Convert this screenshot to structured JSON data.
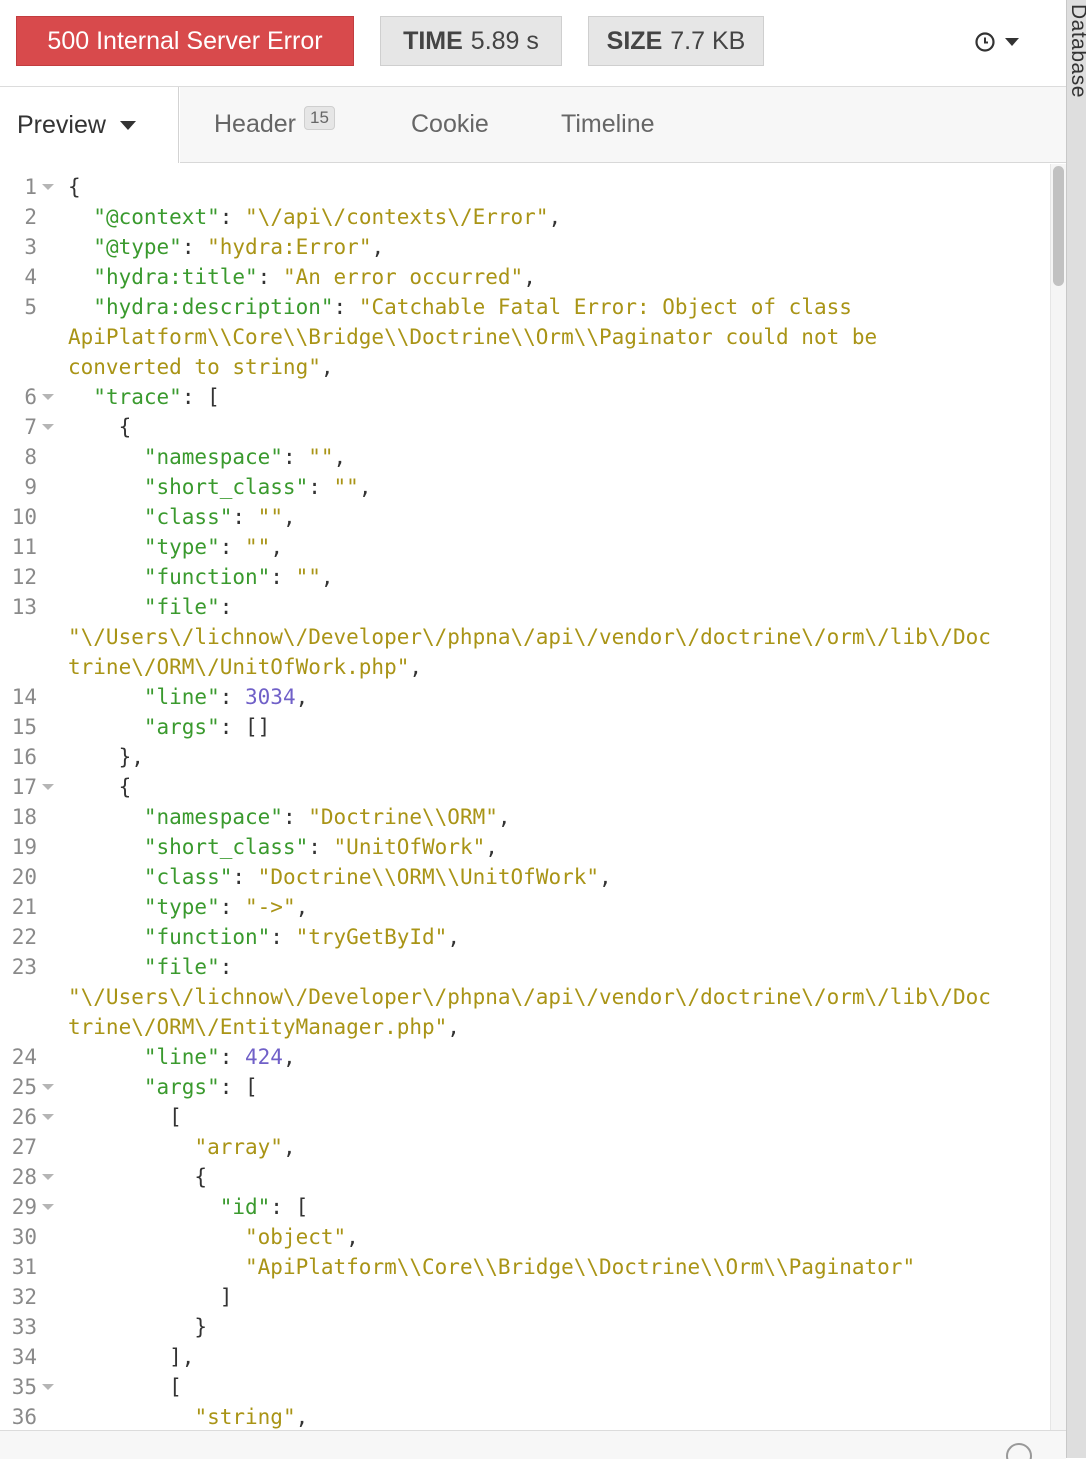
{
  "status": {
    "code": "500",
    "text": "Internal Server Error",
    "color": "#d84a4c"
  },
  "time": {
    "label": "TIME",
    "value": "5.89 s"
  },
  "size": {
    "label": "SIZE",
    "value": "7.7 KB"
  },
  "history": {
    "icon": "clock-icon",
    "caret": "chevron-down-icon"
  },
  "side_panel": {
    "label": "Database"
  },
  "tabs": {
    "preview": "Preview",
    "header": "Header",
    "header_count": "15",
    "cookie": "Cookie",
    "timeline": "Timeline"
  },
  "colors": {
    "key": "#3a9a2e",
    "string": "#a99416",
    "number": "#7060c8",
    "punct": "#333333"
  },
  "code_lines": [
    {
      "n": "1",
      "fold": true,
      "tokens": [
        [
          "p",
          "{"
        ]
      ]
    },
    {
      "n": "2",
      "tokens": [
        [
          "p",
          "  "
        ],
        [
          "k",
          "\"@context\""
        ],
        [
          "p",
          ": "
        ],
        [
          "s",
          "\"\\/api\\/contexts\\/Error\""
        ],
        [
          "p",
          ","
        ]
      ]
    },
    {
      "n": "3",
      "tokens": [
        [
          "p",
          "  "
        ],
        [
          "k",
          "\"@type\""
        ],
        [
          "p",
          ": "
        ],
        [
          "s",
          "\"hydra:Error\""
        ],
        [
          "p",
          ","
        ]
      ]
    },
    {
      "n": "4",
      "tokens": [
        [
          "p",
          "  "
        ],
        [
          "k",
          "\"hydra:title\""
        ],
        [
          "p",
          ": "
        ],
        [
          "s",
          "\"An error occurred\""
        ],
        [
          "p",
          ","
        ]
      ]
    },
    {
      "n": "5",
      "tokens": [
        [
          "p",
          "  "
        ],
        [
          "k",
          "\"hydra:description\""
        ],
        [
          "p",
          ": "
        ],
        [
          "s",
          "\"Catchable Fatal Error: Object of class"
        ]
      ]
    },
    {
      "n": "",
      "tokens": [
        [
          "s",
          "ApiPlatform\\\\Core\\\\Bridge\\\\Doctrine\\\\Orm\\\\Paginator could not be"
        ]
      ]
    },
    {
      "n": "",
      "tokens": [
        [
          "s",
          "converted to string\""
        ],
        [
          "p",
          ","
        ]
      ]
    },
    {
      "n": "6",
      "fold": true,
      "tokens": [
        [
          "p",
          "  "
        ],
        [
          "k",
          "\"trace\""
        ],
        [
          "p",
          ": ["
        ]
      ]
    },
    {
      "n": "7",
      "fold": true,
      "tokens": [
        [
          "p",
          "    {"
        ]
      ]
    },
    {
      "n": "8",
      "tokens": [
        [
          "p",
          "      "
        ],
        [
          "k",
          "\"namespace\""
        ],
        [
          "p",
          ": "
        ],
        [
          "s",
          "\"\""
        ],
        [
          "p",
          ","
        ]
      ]
    },
    {
      "n": "9",
      "tokens": [
        [
          "p",
          "      "
        ],
        [
          "k",
          "\"short_class\""
        ],
        [
          "p",
          ": "
        ],
        [
          "s",
          "\"\""
        ],
        [
          "p",
          ","
        ]
      ]
    },
    {
      "n": "10",
      "tokens": [
        [
          "p",
          "      "
        ],
        [
          "k",
          "\"class\""
        ],
        [
          "p",
          ": "
        ],
        [
          "s",
          "\"\""
        ],
        [
          "p",
          ","
        ]
      ]
    },
    {
      "n": "11",
      "tokens": [
        [
          "p",
          "      "
        ],
        [
          "k",
          "\"type\""
        ],
        [
          "p",
          ": "
        ],
        [
          "s",
          "\"\""
        ],
        [
          "p",
          ","
        ]
      ]
    },
    {
      "n": "12",
      "tokens": [
        [
          "p",
          "      "
        ],
        [
          "k",
          "\"function\""
        ],
        [
          "p",
          ": "
        ],
        [
          "s",
          "\"\""
        ],
        [
          "p",
          ","
        ]
      ]
    },
    {
      "n": "13",
      "tokens": [
        [
          "p",
          "      "
        ],
        [
          "k",
          "\"file\""
        ],
        [
          "p",
          ":"
        ]
      ]
    },
    {
      "n": "",
      "tokens": [
        [
          "s",
          "\"\\/Users\\/lichnow\\/Developer\\/phpna\\/api\\/vendor\\/doctrine\\/orm\\/lib\\/Doc"
        ]
      ]
    },
    {
      "n": "",
      "tokens": [
        [
          "s",
          "trine\\/ORM\\/UnitOfWork.php\""
        ],
        [
          "p",
          ","
        ]
      ]
    },
    {
      "n": "14",
      "tokens": [
        [
          "p",
          "      "
        ],
        [
          "k",
          "\"line\""
        ],
        [
          "p",
          ": "
        ],
        [
          "n",
          "3034"
        ],
        [
          "p",
          ","
        ]
      ]
    },
    {
      "n": "15",
      "tokens": [
        [
          "p",
          "      "
        ],
        [
          "k",
          "\"args\""
        ],
        [
          "p",
          ": []"
        ]
      ]
    },
    {
      "n": "16",
      "tokens": [
        [
          "p",
          "    },"
        ]
      ]
    },
    {
      "n": "17",
      "fold": true,
      "tokens": [
        [
          "p",
          "    {"
        ]
      ]
    },
    {
      "n": "18",
      "tokens": [
        [
          "p",
          "      "
        ],
        [
          "k",
          "\"namespace\""
        ],
        [
          "p",
          ": "
        ],
        [
          "s",
          "\"Doctrine\\\\ORM\""
        ],
        [
          "p",
          ","
        ]
      ]
    },
    {
      "n": "19",
      "tokens": [
        [
          "p",
          "      "
        ],
        [
          "k",
          "\"short_class\""
        ],
        [
          "p",
          ": "
        ],
        [
          "s",
          "\"UnitOfWork\""
        ],
        [
          "p",
          ","
        ]
      ]
    },
    {
      "n": "20",
      "tokens": [
        [
          "p",
          "      "
        ],
        [
          "k",
          "\"class\""
        ],
        [
          "p",
          ": "
        ],
        [
          "s",
          "\"Doctrine\\\\ORM\\\\UnitOfWork\""
        ],
        [
          "p",
          ","
        ]
      ]
    },
    {
      "n": "21",
      "tokens": [
        [
          "p",
          "      "
        ],
        [
          "k",
          "\"type\""
        ],
        [
          "p",
          ": "
        ],
        [
          "s",
          "\"->\""
        ],
        [
          "p",
          ","
        ]
      ]
    },
    {
      "n": "22",
      "tokens": [
        [
          "p",
          "      "
        ],
        [
          "k",
          "\"function\""
        ],
        [
          "p",
          ": "
        ],
        [
          "s",
          "\"tryGetById\""
        ],
        [
          "p",
          ","
        ]
      ]
    },
    {
      "n": "23",
      "tokens": [
        [
          "p",
          "      "
        ],
        [
          "k",
          "\"file\""
        ],
        [
          "p",
          ":"
        ]
      ]
    },
    {
      "n": "",
      "tokens": [
        [
          "s",
          "\"\\/Users\\/lichnow\\/Developer\\/phpna\\/api\\/vendor\\/doctrine\\/orm\\/lib\\/Doc"
        ]
      ]
    },
    {
      "n": "",
      "tokens": [
        [
          "s",
          "trine\\/ORM\\/EntityManager.php\""
        ],
        [
          "p",
          ","
        ]
      ]
    },
    {
      "n": "24",
      "tokens": [
        [
          "p",
          "      "
        ],
        [
          "k",
          "\"line\""
        ],
        [
          "p",
          ": "
        ],
        [
          "n",
          "424"
        ],
        [
          "p",
          ","
        ]
      ]
    },
    {
      "n": "25",
      "fold": true,
      "tokens": [
        [
          "p",
          "      "
        ],
        [
          "k",
          "\"args\""
        ],
        [
          "p",
          ": ["
        ]
      ]
    },
    {
      "n": "26",
      "fold": true,
      "tokens": [
        [
          "p",
          "        ["
        ]
      ]
    },
    {
      "n": "27",
      "tokens": [
        [
          "p",
          "          "
        ],
        [
          "s",
          "\"array\""
        ],
        [
          "p",
          ","
        ]
      ]
    },
    {
      "n": "28",
      "fold": true,
      "tokens": [
        [
          "p",
          "          {"
        ]
      ]
    },
    {
      "n": "29",
      "fold": true,
      "tokens": [
        [
          "p",
          "            "
        ],
        [
          "k",
          "\"id\""
        ],
        [
          "p",
          ": ["
        ]
      ]
    },
    {
      "n": "30",
      "tokens": [
        [
          "p",
          "              "
        ],
        [
          "s",
          "\"object\""
        ],
        [
          "p",
          ","
        ]
      ]
    },
    {
      "n": "31",
      "tokens": [
        [
          "p",
          "              "
        ],
        [
          "s",
          "\"ApiPlatform\\\\Core\\\\Bridge\\\\Doctrine\\\\Orm\\\\Paginator\""
        ]
      ]
    },
    {
      "n": "32",
      "tokens": [
        [
          "p",
          "            ]"
        ]
      ]
    },
    {
      "n": "33",
      "tokens": [
        [
          "p",
          "          }"
        ]
      ]
    },
    {
      "n": "34",
      "tokens": [
        [
          "p",
          "        ],"
        ]
      ]
    },
    {
      "n": "35",
      "fold": true,
      "tokens": [
        [
          "p",
          "        ["
        ]
      ]
    },
    {
      "n": "36",
      "tokens": [
        [
          "p",
          "          "
        ],
        [
          "s",
          "\"string\""
        ],
        [
          "p",
          ","
        ]
      ]
    }
  ]
}
